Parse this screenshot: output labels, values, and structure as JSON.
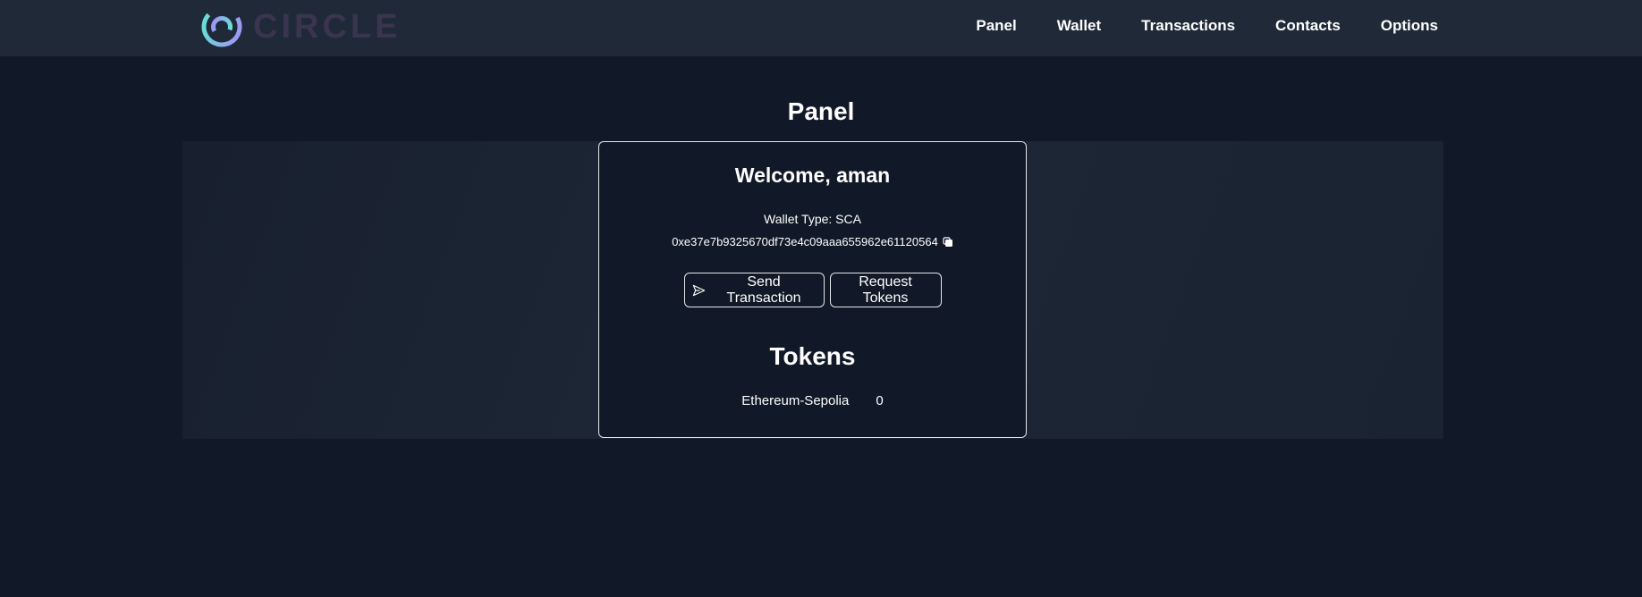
{
  "navbar": {
    "logo_text": "CIRCLE",
    "links": [
      "Panel",
      "Wallet",
      "Transactions",
      "Contacts",
      "Options"
    ]
  },
  "page": {
    "title": "Panel"
  },
  "card": {
    "welcome": "Welcome, aman",
    "wallet_type": "Wallet Type: SCA",
    "address": "0xe37e7b9325670df73e4c09aaa655962e61120564",
    "send_button": "Send Transaction",
    "request_button": "Request Tokens",
    "tokens_title": "Tokens",
    "tokens": [
      {
        "name": "Ethereum-Sepolia",
        "amount": "0"
      }
    ]
  },
  "icons": {
    "logo": "circle-logo-icon",
    "copy": "copy-icon",
    "send": "send-icon"
  },
  "colors": {
    "background": "#111827",
    "navbar": "#1f2937",
    "logo_text": "#3b3450",
    "logo_gradient_start": "#5eead4",
    "logo_gradient_end": "#a78bfa"
  }
}
